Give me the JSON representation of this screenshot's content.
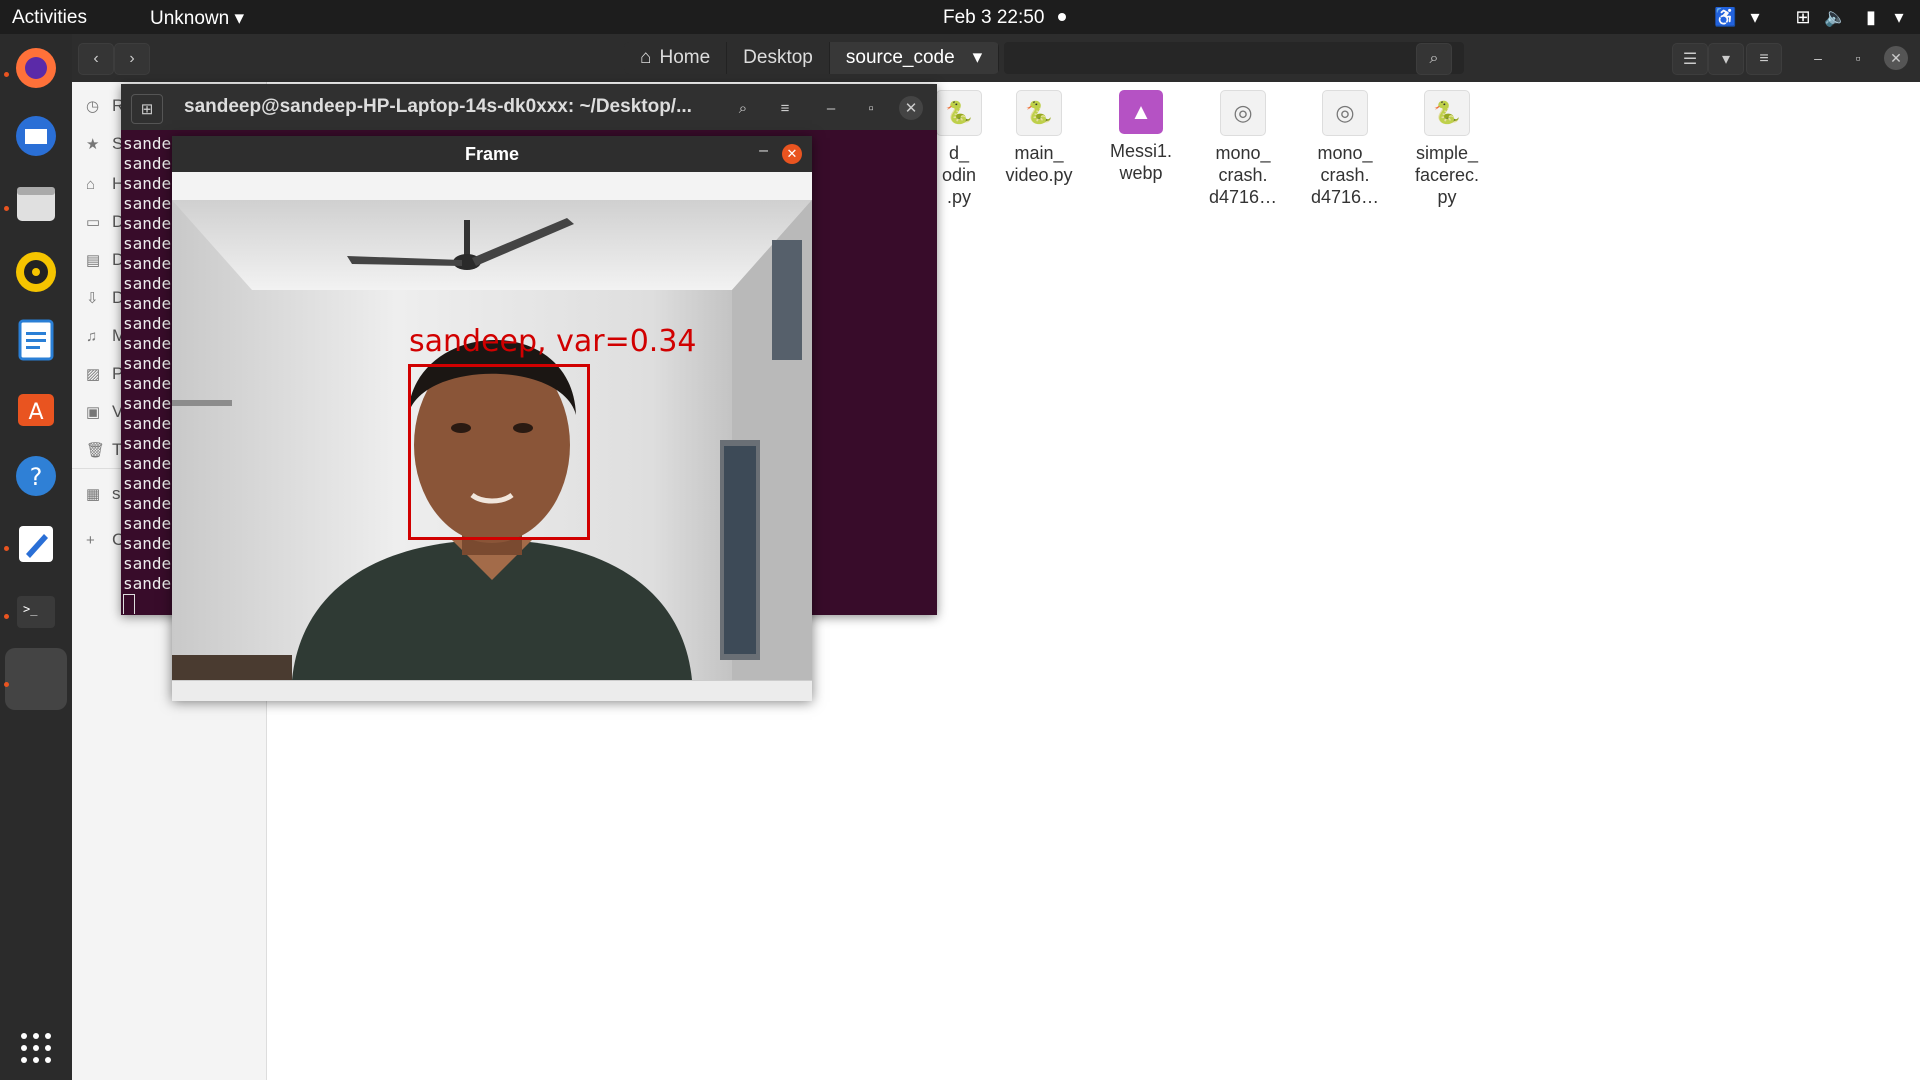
{
  "topbar": {
    "activities": "Activities",
    "app_menu": "Unknown ▾",
    "clock": "Feb 3  22:50",
    "tray_icons": [
      "accessibility-icon",
      "network-icon",
      "volume-icon",
      "battery-icon",
      "power-menu-icon"
    ]
  },
  "dock": {
    "apps": [
      {
        "name": "firefox-icon",
        "color": "#ff7139"
      },
      {
        "name": "thunderbird-icon",
        "color": "#2a6fd6"
      },
      {
        "name": "files-icon",
        "color": "#d9d9d9"
      },
      {
        "name": "rhythmbox-icon",
        "color": "#f5c400"
      },
      {
        "name": "writer-icon",
        "color": "#2a7fd6"
      },
      {
        "name": "software-icon",
        "color": "#e95420"
      },
      {
        "name": "help-icon",
        "color": "#2f80d6"
      },
      {
        "name": "text-editor-icon",
        "color": "#ffffff"
      },
      {
        "name": "terminal-icon",
        "color": "#3a3a3a"
      }
    ],
    "show_apps_icon": "app-grid-icon"
  },
  "files": {
    "breadcrumbs": [
      "Home",
      "Desktop",
      "source_code"
    ],
    "sidebar": [
      "R",
      "S",
      "H",
      "D",
      "D",
      "D",
      "M",
      "P",
      "V",
      "T",
      "s",
      "C"
    ],
    "items": [
      {
        "name": "d_\nodin\n.py",
        "type": "py"
      },
      {
        "name": "main_\nvideo.py",
        "type": "py"
      },
      {
        "name": "Messi1.\nwebp",
        "type": "img"
      },
      {
        "name": "mono_\ncrash.\nd4716…",
        "type": "crash"
      },
      {
        "name": "mono_\ncrash.\nd4716…",
        "type": "crash"
      },
      {
        "name": "simple_\nfacerec.\npy",
        "type": "py"
      }
    ]
  },
  "terminal": {
    "title": "sandeep@sandeep-HP-Laptop-14s-dk0xxx: ~/Desktop/...",
    "lines": [
      "sande",
      "sande",
      "sande",
      "sande",
      "sande",
      "sande",
      "sande",
      "sande",
      "sande",
      "sande",
      "sande",
      "sande",
      "sande",
      "sande",
      "sande",
      "sande",
      "sande",
      "sande",
      "sande",
      "sande",
      "sande",
      "sande",
      "sande"
    ]
  },
  "frame": {
    "title": "Frame",
    "overlay_label": "sandeep, var=0.34"
  }
}
